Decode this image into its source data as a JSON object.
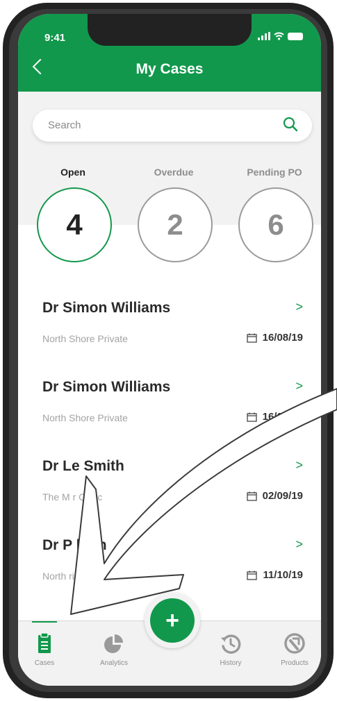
{
  "status_bar": {
    "time": "9:41"
  },
  "header": {
    "title": "My Cases",
    "back_icon": "chevron-left-icon"
  },
  "search": {
    "placeholder": "Search",
    "icon": "search-icon"
  },
  "filters": [
    {
      "label": "Open",
      "count": "4",
      "active": true
    },
    {
      "label": "Overdue",
      "count": "2",
      "active": false
    },
    {
      "label": "Pending PO",
      "count": "6",
      "active": false
    }
  ],
  "cases": [
    {
      "name": "Dr Simon Williams",
      "hospital": "North Shore Private",
      "date": "16/08/19"
    },
    {
      "name": "Dr Simon Williams",
      "hospital": "North Shore Private",
      "date": "16/08/19"
    },
    {
      "name": "Dr Le Smith",
      "hospital": "The M r Clinic",
      "date": "02/09/19"
    },
    {
      "name": "Dr P l P n",
      "hospital": "North  rivat",
      "date": "11/10/19"
    }
  ],
  "tabbar": {
    "items": [
      {
        "label": "Cases",
        "icon": "clipboard-icon",
        "active": true
      },
      {
        "label": "Analytics",
        "icon": "pie-chart-icon",
        "active": false
      },
      {
        "label": "History",
        "icon": "history-icon",
        "active": false
      },
      {
        "label": "Products",
        "icon": "products-icon",
        "active": false
      }
    ],
    "fab_label": "+"
  },
  "colors": {
    "accent": "#12984c",
    "inactive": "#8d8d8d"
  }
}
